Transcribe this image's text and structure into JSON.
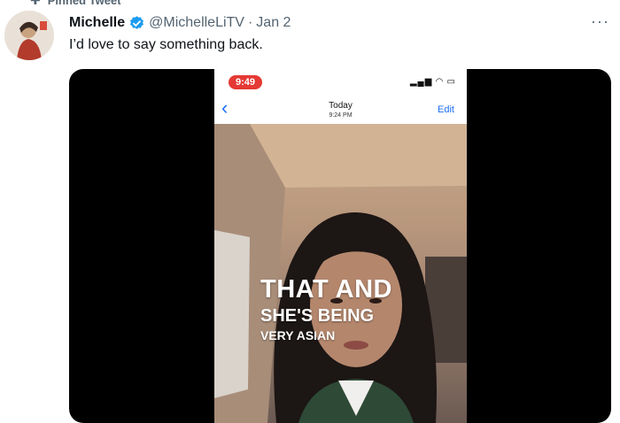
{
  "pinned_label": "Pinned Tweet",
  "tweet": {
    "name": "Michelle",
    "handle": "@MichelleLiTV",
    "separator": "·",
    "date": "Jan 2",
    "text": "I’d love to say something back.",
    "more": "···"
  },
  "phone": {
    "time": "9:49",
    "signal": "▂▄▆ ◠ ▭",
    "back": "‹",
    "title": "Today",
    "subtitle": "9:24 PM",
    "edit": "Edit"
  },
  "captions": {
    "line1": "THAT AND",
    "line2": "SHE'S BEING",
    "line3": "VERY ASIAN"
  },
  "colors": {
    "verified": "#1d9bf0",
    "ios_blue": "#1d6ff2",
    "recording_pill": "#e53935"
  },
  "icons": {
    "pin": "pin-icon",
    "verified": "verified-badge-icon",
    "more": "more-icon",
    "back": "chevron-left-icon"
  }
}
